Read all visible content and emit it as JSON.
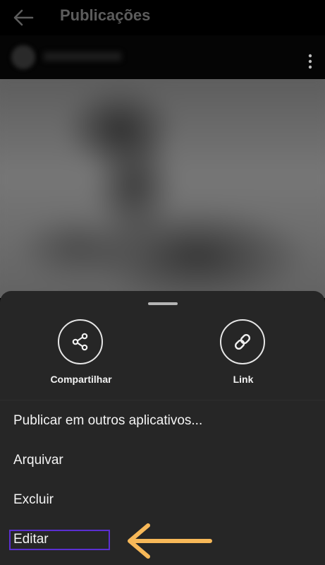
{
  "topbar": {
    "title": "Publicações",
    "back_icon": "arrow-left-icon"
  },
  "post": {
    "more_icon": "more-vertical-icon"
  },
  "sheet": {
    "actions": [
      {
        "label": "Compartilhar",
        "icon": "share-icon"
      },
      {
        "label": "Link",
        "icon": "link-icon"
      }
    ],
    "menu": [
      {
        "label": "Publicar em outros aplicativos..."
      },
      {
        "label": "Arquivar"
      },
      {
        "label": "Excluir"
      },
      {
        "label": "Editar"
      }
    ]
  },
  "annotation": {
    "highlight_color": "#5b2fd1",
    "arrow_color": "#f7b858",
    "arrow_icon": "arrow-left-annotation-icon"
  },
  "colors": {
    "sheet_background": "#262626",
    "text_primary": "#f4f4f4"
  }
}
